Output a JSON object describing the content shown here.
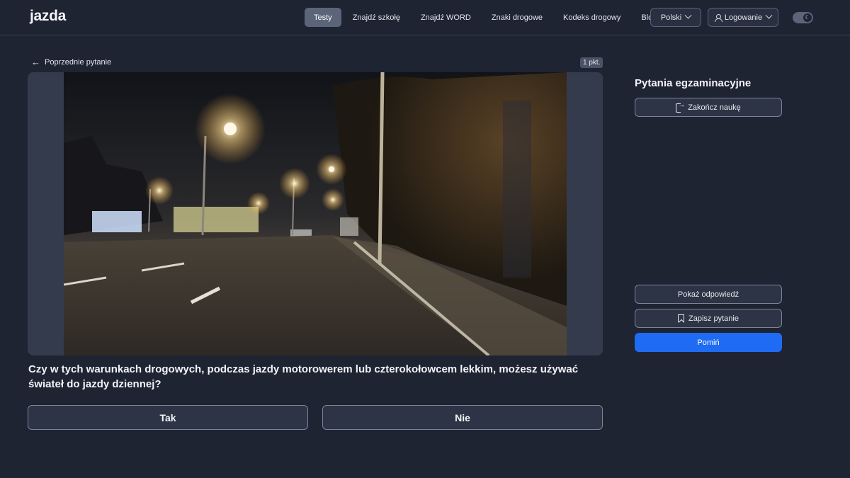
{
  "header": {
    "logo": "jazda",
    "nav": [
      {
        "label": "Testy",
        "active": true
      },
      {
        "label": "Znajdź szkołę",
        "active": false
      },
      {
        "label": "Znajdź WORD",
        "active": false
      },
      {
        "label": "Znaki drogowe",
        "active": false
      },
      {
        "label": "Kodeks drogowy",
        "active": false
      },
      {
        "label": "Blog",
        "active": false
      }
    ],
    "language": "Polski",
    "login": "Logowanie",
    "theme_icon": "moon-icon"
  },
  "question": {
    "prev_label": "Poprzednie pytanie",
    "points": "1 pkt.",
    "text": "Czy w tych warunkach drogowych, podczas jazdy motorowerem lub czterokołowcem lekkim, możesz używać świateł do jazdy dziennej?",
    "answers": [
      "Tak",
      "Nie"
    ]
  },
  "side": {
    "title": "Pytania egzaminacyjne",
    "finish": "Zakończ naukę",
    "show_answer": "Pokaż odpowiedź",
    "save_question": "Zapisz pytanie",
    "skip": "Pomiń"
  },
  "colors": {
    "background": "#1f2433",
    "accent": "#1f6bf3",
    "active_nav": "#5b6478"
  }
}
